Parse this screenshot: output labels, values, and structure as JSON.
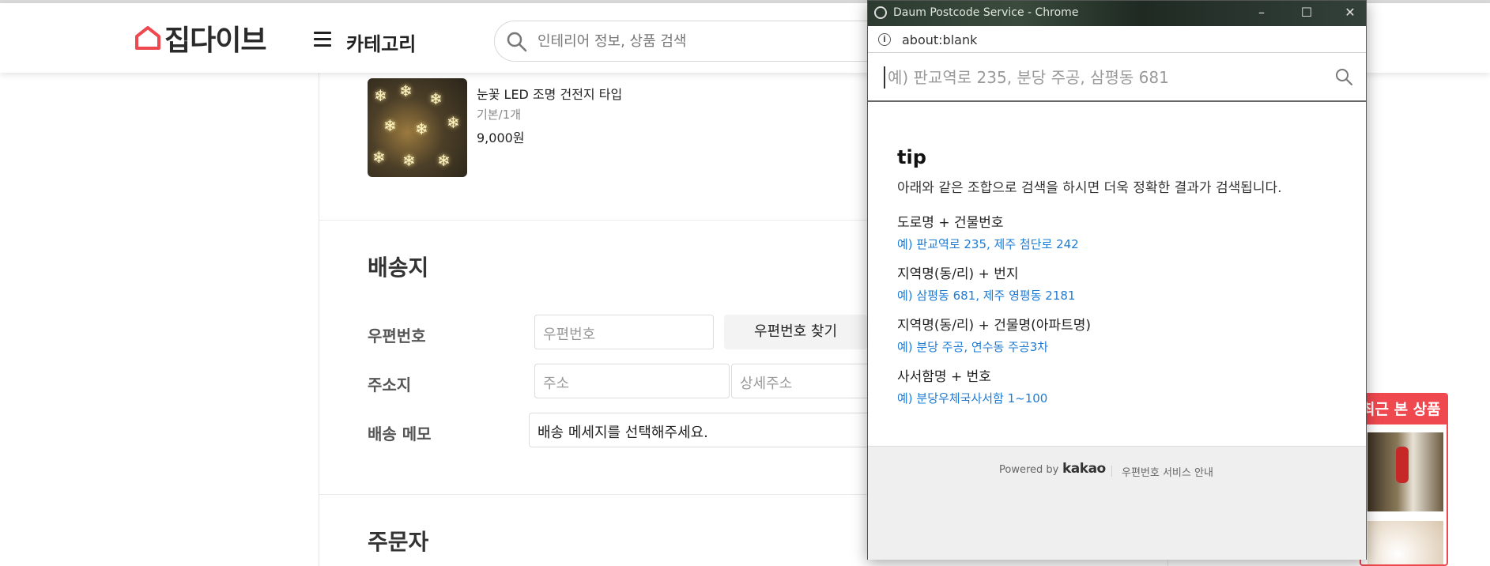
{
  "header": {
    "logo_text": "집다이브",
    "category_label": "카테고리",
    "search_placeholder": "인테리어 정보, 상품 검색"
  },
  "product": {
    "name": "눈꽃 LED 조명 건전지 타입",
    "option": "기본/1개",
    "price": "9,000원"
  },
  "shipping": {
    "title": "배송지",
    "postal_label": "우편번호",
    "postal_placeholder": "우편번호",
    "find_postal_button": "우편번호 찾기",
    "address_label": "주소지",
    "address_placeholder": "주소",
    "detail_address_placeholder": "상세주소",
    "memo_label": "배송 메모",
    "memo_value": "배송 메세지를 선택해주세요."
  },
  "orderer": {
    "title": "주문자"
  },
  "recent": {
    "title": "최근 본 상품"
  },
  "popup": {
    "window_title": "Daum Postcode Service - Chrome",
    "url": "about:blank",
    "search_placeholder": "예) 판교역로 235, 분당 주공, 삼평동 681",
    "tip_title": "tip",
    "tip_desc": "아래와 같은 조합으로 검색을 하시면 더욱 정확한 결과가 검색됩니다.",
    "tips": [
      {
        "title": "도로명 + 건물번호",
        "example": "예) 판교역로 235,  제주 첨단로 242"
      },
      {
        "title": "지역명(동/리) + 번지",
        "example": "예) 삼평동 681,  제주 영평동 2181"
      },
      {
        "title": "지역명(동/리) + 건물명(아파트명)",
        "example": "예) 분당 주공,  연수동 주공3차"
      },
      {
        "title": "사서함명 + 번호",
        "example": "예) 분당우체국사서함 1~100"
      }
    ],
    "footer_powered": "Powered by",
    "footer_brand": "kakao",
    "footer_guide": "우편번호 서비스 안내"
  },
  "colors": {
    "brand_red": "#f0484f",
    "link_blue": "#1e7bd4"
  }
}
